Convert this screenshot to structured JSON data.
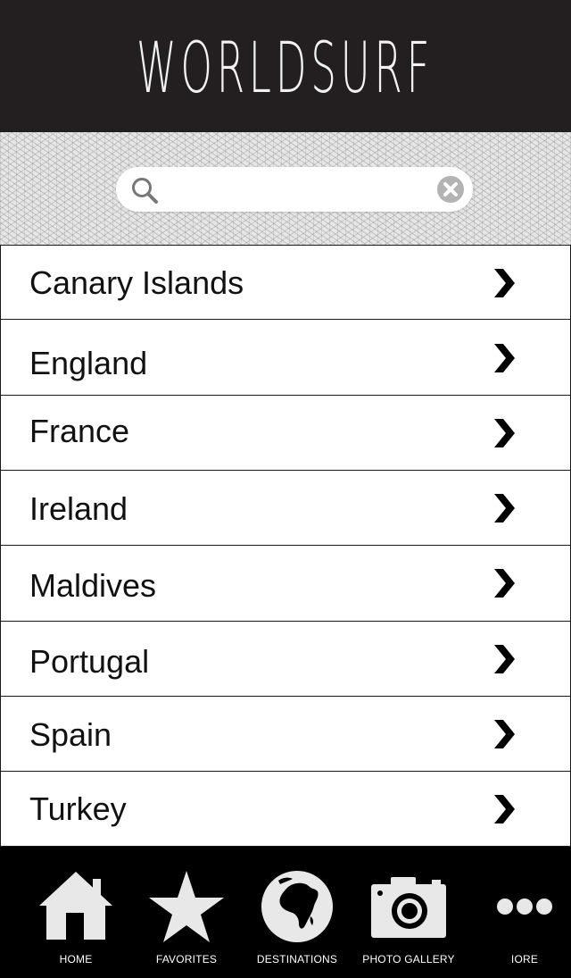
{
  "header": {
    "logo": "WORLDSURF"
  },
  "search": {
    "value": "",
    "placeholder": ""
  },
  "destinations": [
    {
      "label": "Canary Islands"
    },
    {
      "label": "England"
    },
    {
      "label": "France"
    },
    {
      "label": "Ireland"
    },
    {
      "label": "Maldives"
    },
    {
      "label": "Portugal"
    },
    {
      "label": "Spain"
    },
    {
      "label": "Turkey"
    }
  ],
  "tabbar": {
    "tabs": [
      {
        "label": "HOME",
        "icon": "home-icon"
      },
      {
        "label": "FAVORITES",
        "icon": "star-icon"
      },
      {
        "label": "DESTINATIONS",
        "icon": "globe-icon"
      },
      {
        "label": "PHOTO GALLERY",
        "icon": "camera-icon"
      },
      {
        "label": "IORE",
        "icon": "more-icon"
      }
    ]
  },
  "colors": {
    "header_bg": "#231f20",
    "tabbar_bg": "#000000",
    "icon_fill": "#e8e8e8"
  }
}
